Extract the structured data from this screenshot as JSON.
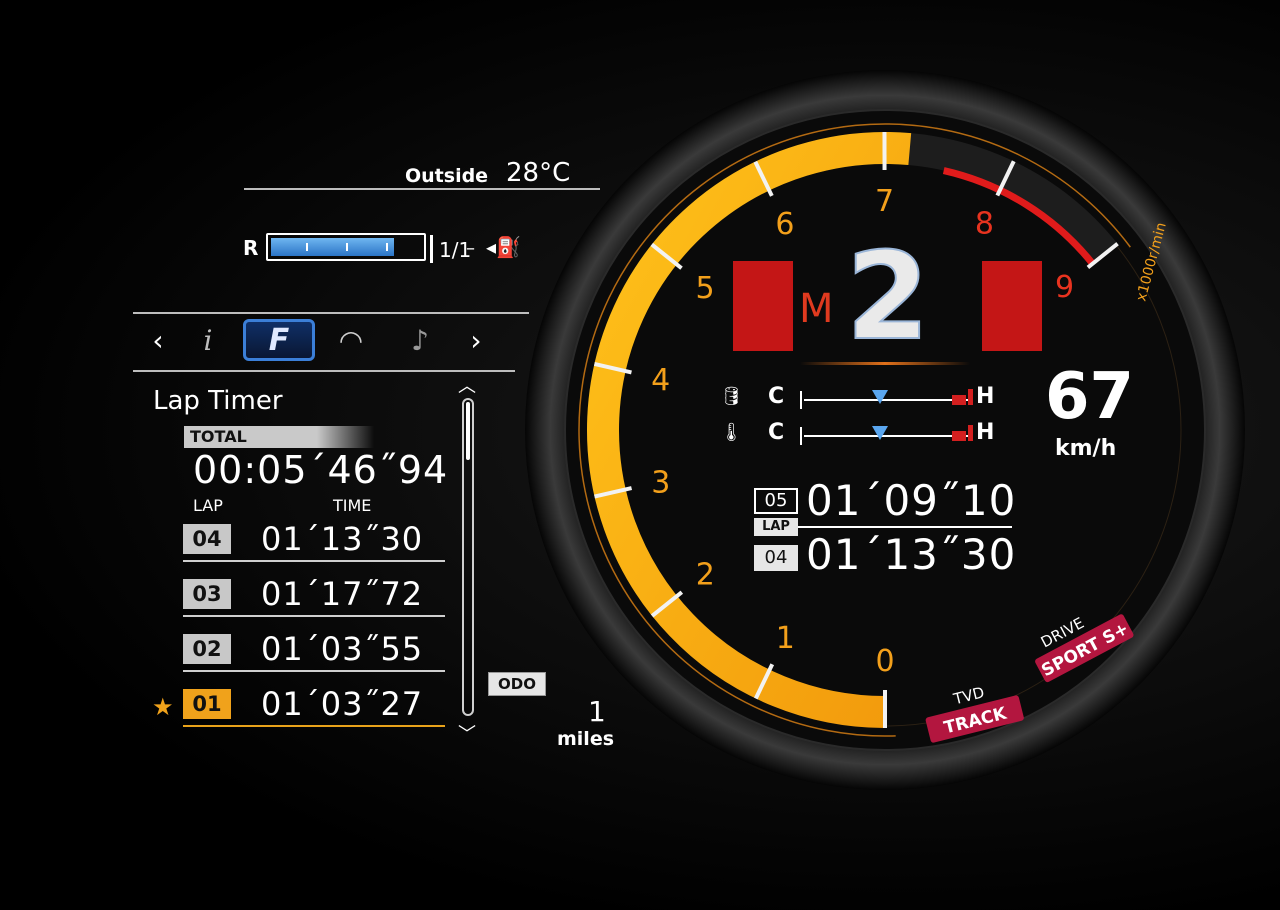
{
  "outside": {
    "label": "Outside",
    "value": "28°C"
  },
  "fuel": {
    "empty_label": "R",
    "full_label": "1/1",
    "level": 0.82,
    "icon": "fuel-pump-icon"
  },
  "tabs": [
    {
      "name": "prev",
      "glyph": "‹"
    },
    {
      "name": "info",
      "glyph": "i"
    },
    {
      "name": "f-sport",
      "glyph": "F"
    },
    {
      "name": "gauge",
      "glyph": "◠"
    },
    {
      "name": "audio",
      "glyph": "♪"
    },
    {
      "name": "next",
      "glyph": "›"
    }
  ],
  "lap_timer": {
    "title": "Lap Timer",
    "total_label": "TOTAL",
    "total_time": "00:05´46˝94",
    "col_lap": "LAP",
    "col_time": "TIME",
    "laps": [
      {
        "num": "04",
        "time": "01´13˝30",
        "best": false
      },
      {
        "num": "03",
        "time": "01´17˝72",
        "best": false
      },
      {
        "num": "02",
        "time": "01´03˝55",
        "best": false
      },
      {
        "num": "01",
        "time": "01´03˝27",
        "best": true
      }
    ],
    "best_marker": "★"
  },
  "odo": {
    "label": "ODO",
    "value": "1",
    "unit": "miles"
  },
  "tach": {
    "ticks": [
      "0",
      "1",
      "2",
      "3",
      "4",
      "5",
      "6",
      "7",
      "8",
      "9"
    ],
    "unit": "x1000r/min",
    "rpm": 7.2,
    "redline": 7.5,
    "colors": {
      "fill": "#f3b514",
      "redzone": "#e01b1b",
      "tick_label": "#f3a01b",
      "red_label": "#e8331f"
    }
  },
  "gear": {
    "mode": "M",
    "number": "2"
  },
  "temps": [
    {
      "icon": "oil-temp-icon",
      "cold": "C",
      "hot": "H",
      "level": 0.45
    },
    {
      "icon": "coolant-temp-icon",
      "cold": "C",
      "hot": "H",
      "level": 0.45
    }
  ],
  "speed": {
    "value": "67",
    "unit": "km/h"
  },
  "current_lap": {
    "num": "05",
    "time": "01´09˝10",
    "tag": "LAP"
  },
  "previous_lap": {
    "num": "04",
    "time": "01´13˝30"
  },
  "modes": {
    "tvd_label": "TVD",
    "tvd_value": "TRACK",
    "drive_label": "DRIVE",
    "drive_value": "SPORT S+"
  }
}
